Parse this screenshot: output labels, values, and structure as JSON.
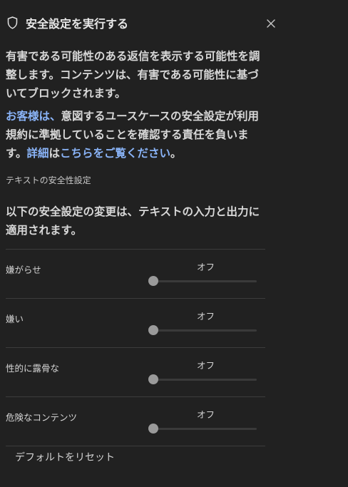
{
  "header": {
    "title": "安全設定を実行する",
    "shield_icon": "shield-icon",
    "close_icon": "close-icon"
  },
  "description": "有害である可能性のある返信を表示する可能性を調整します。コンテンツは、有害である可能性に基づいてブロックされます。",
  "notice": {
    "customer_link": "お客様は、",
    "text_1": "意図するユースケースの安全設定が利用規約に準拠していることを確認する責任を負います。",
    "details_link": "詳細",
    "text_2": "は",
    "here_link": "こちらをご覧ください",
    "text_3": "。"
  },
  "text_safety": {
    "label": "テキストの安全性設定",
    "description": "以下の安全設定の変更は、テキストの入力と出力に適用されます。"
  },
  "settings": [
    {
      "name": "嫌がらせ",
      "value": "オフ",
      "level": 0
    },
    {
      "name": "嫌い",
      "value": "オフ",
      "level": 0
    },
    {
      "name": "性的に露骨な",
      "value": "オフ",
      "level": 0
    },
    {
      "name": "危険なコンテンツ",
      "value": "オフ",
      "level": 0
    }
  ],
  "reset_label": "デフォルトをリセット",
  "colors": {
    "background": "#212121",
    "link": "#8ab4f8",
    "divider": "#3c3c3c",
    "thumb": "#9a9a9a"
  }
}
